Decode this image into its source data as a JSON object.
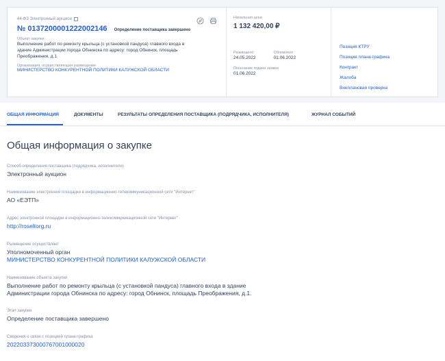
{
  "card": {
    "law_label": "44-ФЗ Электронный аукцион",
    "purchase_number": "№ 0137200001222002146",
    "stage_top": "Определение поставщика завершено",
    "object_label": "Объект закупки",
    "object_text_line1": "Выполнение работ по ремонту крыльца (с установкой пандуса) главного входа в",
    "object_text_line2": "здание Администрации города Обнинска по адресу: город Обнинск, площадь",
    "object_text_line3": "Преображения, д.1.",
    "org_label": "Организация, осуществляющая размещение",
    "org_name": "МИНИСТЕРСТВО КОНКУРЕНТНОЙ ПОЛИТИКИ КАЛУЖСКОЙ ОБЛАСТИ",
    "price_label": "Начальная цена",
    "price": "1 132 420,00 ₽",
    "posted_label": "Размещено",
    "posted_date": "24.05.2022",
    "updated_label": "Обновлено",
    "updated_date": "01.06.2022",
    "deadline_label": "Окончание подачи заявок",
    "deadline_date": "01.06.2022",
    "links": [
      "Позиция КТРУ",
      "Позиция плана-графика",
      "Контракт",
      "Жалоба",
      "Внеплановая проверка"
    ]
  },
  "tabs": [
    "ОБЩАЯ ИНФОРМАЦИЯ",
    "ДОКУМЕНТЫ",
    "РЕЗУЛЬТАТЫ ОПРЕДЕЛЕНИЯ ПОСТАВЩИКА (ПОДРЯДЧИКА, ИСПОЛНИТЕЛЯ)",
    "ЖУРНАЛ СОБЫТИЙ"
  ],
  "main": {
    "title": "Общая информация о закупке",
    "method_label": "Способ определения поставщика (подрядчика, исполнителя)",
    "method": "Электронный аукцион",
    "platform_label": "Наименование электронной площадки в информационно-телекоммуникационной сети \"Интернет\"",
    "platform": "АО «ЕЭТП»",
    "platform_url_label": "Адрес электронной площадки в информационно-телекоммуникационной сети \"Интернет\"",
    "platform_url": "http://roseltorg.ru",
    "placement_label": "Размещение осуществляет",
    "placement_role": "Уполномоченный орган",
    "placement_org": "МИНИСТЕРСТВО КОНКУРЕНТНОЙ ПОЛИТИКИ КАЛУЖСКОЙ ОБЛАСТИ",
    "object_label": "Наименование объекта закупки",
    "object_line1": "Выполнение работ по ремонту крыльца (с установкой пандуса) главного входа в здание",
    "object_line2": "Администрации города Обнинска по адресу: город Обнинск, площадь Преображения, д.1.",
    "stage_label": "Этап закупки",
    "stage": "Определение поставщика завершено",
    "plan_label": "Сведения о связи с позицией плана-графика",
    "plan_link": "202203373000767001000020"
  }
}
